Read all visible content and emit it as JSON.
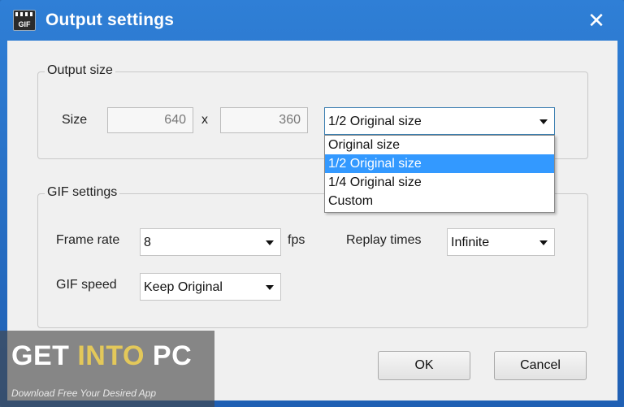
{
  "window": {
    "title": "Output settings",
    "app_icon_text": "GIF",
    "close_glyph": "✕"
  },
  "output_size": {
    "group_title": "Output size",
    "size_label": "Size",
    "width": "640",
    "times": "x",
    "height": "360",
    "preset_selected": "1/2 Original size",
    "preset_options": [
      "Original size",
      "1/2 Original size",
      "1/4 Original size",
      "Custom"
    ],
    "highlighted_option": "1/2 Original size"
  },
  "gif_settings": {
    "group_title": "GIF settings",
    "frame_rate_label": "Frame rate",
    "frame_rate_value": "8",
    "fps_unit": "fps",
    "replay_label": "Replay times",
    "replay_value": "Infinite",
    "speed_label": "GIF speed",
    "speed_value": "Keep Original"
  },
  "buttons": {
    "ok": "OK",
    "cancel": "Cancel"
  },
  "watermark": {
    "part1": "GET ",
    "part2": "INTO",
    "part3": " PC",
    "tagline": "Download Free Your Desired App"
  },
  "colors": {
    "titlebar": "#2f7fd6",
    "selection": "#3399ff",
    "watermark_accent": "#e3c85a"
  }
}
